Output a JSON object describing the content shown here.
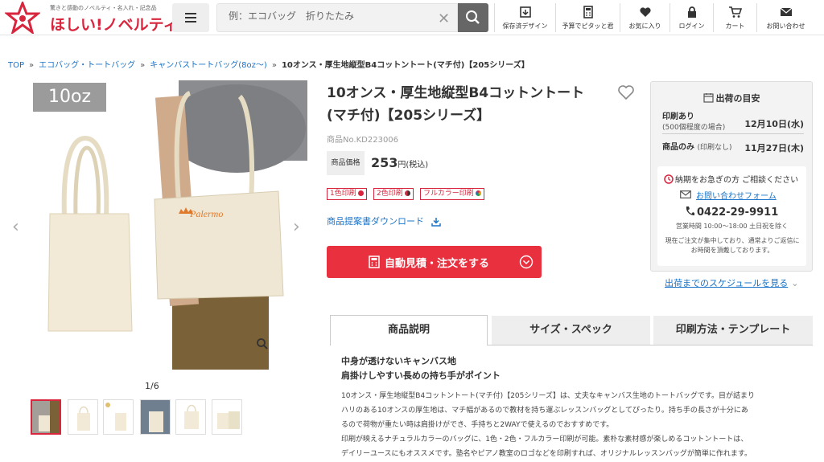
{
  "header": {
    "logo_tagline": "驚きと感動のノベルティ・名入れ・記念品",
    "logo_text": "ほしい!ノベルティ",
    "search": {
      "placeholder": "例：エコバッグ　折りたたみ"
    },
    "nav": [
      {
        "label": "保存済デザイン",
        "icon": "saved-design-icon"
      },
      {
        "label": "予算でピタッと君",
        "icon": "calculator-icon"
      },
      {
        "label": "お気に入り",
        "icon": "heart-icon"
      },
      {
        "label": "ログイン",
        "icon": "lock-icon"
      },
      {
        "label": "カート",
        "icon": "cart-icon"
      },
      {
        "label": "お問い合わせ",
        "icon": "mail-icon"
      }
    ]
  },
  "breadcrumb": {
    "items": [
      "TOP",
      "エコバッグ・トートバッグ",
      "キャンバストートバッグ(8oz～)"
    ],
    "separator": "»",
    "current": "10オンス・厚生地縦型B4コットントート(マチ付)【205シリーズ】"
  },
  "gallery": {
    "badge": "10oz",
    "counter": "1/6",
    "print_text": "Palermo",
    "thumbnails": 6
  },
  "product": {
    "title": "10オンス・厚生地縦型B4コットントート(マチ付)【205シリーズ】",
    "number": "商品No.KD223006",
    "price_label": "商品価格",
    "price": "253",
    "price_unit": "円(税込)",
    "print_tags": [
      "1色印刷",
      "2色印刷",
      "フルカラー印刷"
    ],
    "download_link": "商品提案書ダウンロード",
    "order_button": "自動見積・注文をする"
  },
  "shipping": {
    "heading": "出荷の目安",
    "rows": [
      {
        "label": "印刷あり",
        "sub": "(500個程度の場合)",
        "date": "12月10日(水)"
      },
      {
        "label": "商品のみ",
        "sub": "(印刷なし)",
        "date": "11月27日(木)"
      }
    ],
    "urgent_title": "納期をお急ぎの方 ご相談ください",
    "contact_link": "お問い合わせフォーム",
    "phone": "0422-29-9911",
    "hours": "営業時間 10:00～18:00 土日祝を除く",
    "note": "現在ご注文が集中しており、通常よりご返信にお時間を頂戴しております。",
    "schedule_link": "出荷までのスケジュールを見る"
  },
  "tabs": [
    "商品説明",
    "サイズ・スペック",
    "印刷方法・テンプレート"
  ],
  "description": {
    "headlines": [
      "中身が透けないキャンバス地",
      "肩掛けしやすい長めの持ち手がポイント"
    ],
    "lines": [
      "10オンス・厚生地縦型B4コットントート(マチ付)【205シリーズ】は、丈夫なキャンバス生地のトートバッグです。目が詰まり",
      "ハリのある10オンスの厚生地は、マチ幅があるので教材を持ち運ぶレッスンバッグとしてぴったり。持ち手の長さが十分にあ",
      "るので荷物が重たい時は肩掛けができ、手持ちと2WAYで使えるのでおすすめです。",
      "印刷が映えるナチュラルカラーのバッグに、1色・2色・フルカラー印刷が可能。素朴な素材感が楽しめるコットントートは、",
      "デイリーユースにもオススメです。塾名やピアノ教室のロゴなどを印刷すれば、オリジナルレッスンバッグが簡単に作れます。"
    ]
  },
  "colors": {
    "brand_red": "#d7263d",
    "link_blue": "#1a73c8",
    "order_red": "#e8303f"
  }
}
